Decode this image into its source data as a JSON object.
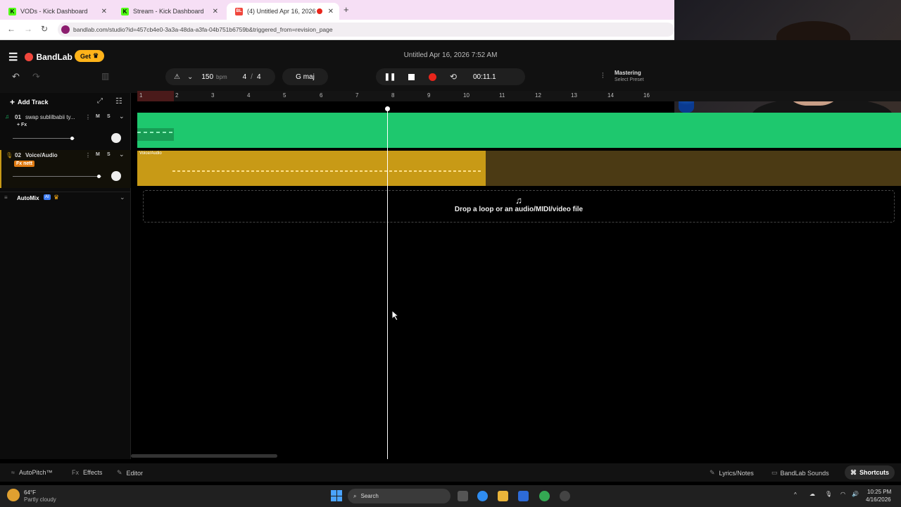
{
  "browser": {
    "tabs": [
      {
        "label": "VODs - Kick Dashboard",
        "favicon": "K"
      },
      {
        "label": "Stream - Kick Dashboard",
        "favicon": "K"
      },
      {
        "label": "(4) Untitled Apr 16, 2026 7:...",
        "favicon": "BL"
      }
    ],
    "url": "bandlab.com/studio?id=457cb4e0-3a3a-48da-a3fa-04b751b6759b&triggered_from=revision_page"
  },
  "app": {
    "brand": "BandLab",
    "get_label": "Get",
    "project_title": "Untitled Apr 16, 2026 7:52 AM",
    "tempo": "150",
    "tempo_unit": "bpm",
    "time_sig_num": "4",
    "time_sig_den": "4",
    "key": "G maj",
    "time": "00:11.1",
    "mastering_label": "Mastering",
    "mastering_preset": "Select Preset"
  },
  "sidebar": {
    "add_track": "Add Track",
    "tracks": [
      {
        "number": "01",
        "name": "swap sublilbabii ty...",
        "fx": "+ Fx",
        "mute": "M",
        "solo": "S"
      },
      {
        "number": "02",
        "name": "Voice/Audio",
        "fx": "Fx nett",
        "mute": "M",
        "solo": "S"
      }
    ],
    "automix": "AutoMix",
    "automix_badge": "AI"
  },
  "ruler": [
    "1",
    "2",
    "3",
    "4",
    "5",
    "6",
    "7",
    "8",
    "9",
    "10",
    "11",
    "12",
    "13",
    "14",
    "16"
  ],
  "timeline": {
    "track2_region_label": "Voice/Audio",
    "drop_text": "Drop a loop or an audio/MIDI/video file"
  },
  "bottom": {
    "autopitch": "AutoPitch™",
    "effects": "Effects",
    "editor": "Editor",
    "lyrics": "Lyrics/Notes",
    "sounds": "BandLab Sounds",
    "shortcuts": "Shortcuts"
  },
  "taskbar": {
    "weather_temp": "64°F",
    "weather_desc": "Partly cloudy",
    "search": "Search",
    "time": "10:25 PM",
    "date": "4/16/2026"
  },
  "colors": {
    "track1": "#1ec86e",
    "track2": "#c89a16",
    "get": "#ffb31a",
    "record": "#e8251b"
  }
}
